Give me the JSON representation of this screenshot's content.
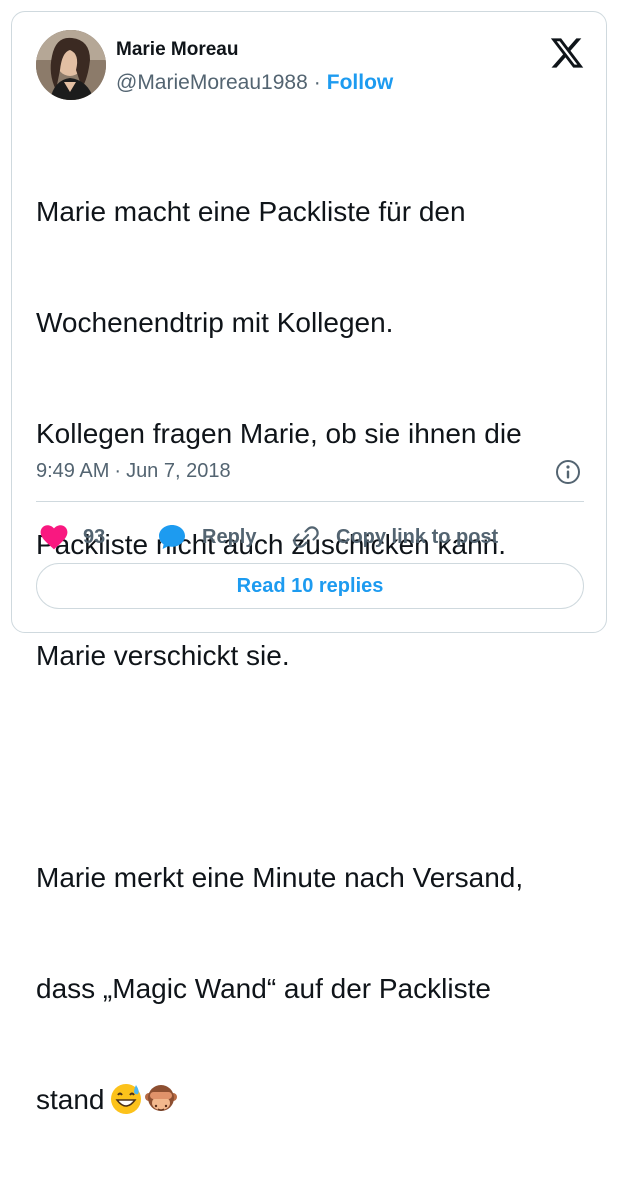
{
  "author": {
    "display_name": "Marie Moreau",
    "handle": "@MarieMoreau1988",
    "separator": "·",
    "follow_label": "Follow"
  },
  "platform": {
    "logo_icon": "x-logo-icon"
  },
  "tweet": {
    "lines": [
      "Marie macht eine Packliste für den",
      "Wochenendtrip mit Kollegen.",
      "Kollegen fragen Marie, ob sie ihnen die",
      "Packliste nicht auch zuschicken kann.",
      "Marie verschickt sie.",
      "",
      "Marie merkt eine Minute nach Versand,",
      "dass „Magic Wand“ auf der Packliste",
      "stand"
    ],
    "emojis": [
      "grinning-sweat-emoji",
      "see-no-evil-monkey-emoji"
    ]
  },
  "meta": {
    "time": "9:49 AM",
    "separator": "·",
    "date": "Jun 7, 2018"
  },
  "actions": {
    "like_count": "93",
    "reply_label": "Reply",
    "copy_label": "Copy link to post"
  },
  "read_replies_label": "Read 10 replies",
  "colors": {
    "accent": "#1d9bf0",
    "heart": "#f91880",
    "text": "#0f1419",
    "secondary_text": "#536471",
    "border": "#cfd9de"
  }
}
